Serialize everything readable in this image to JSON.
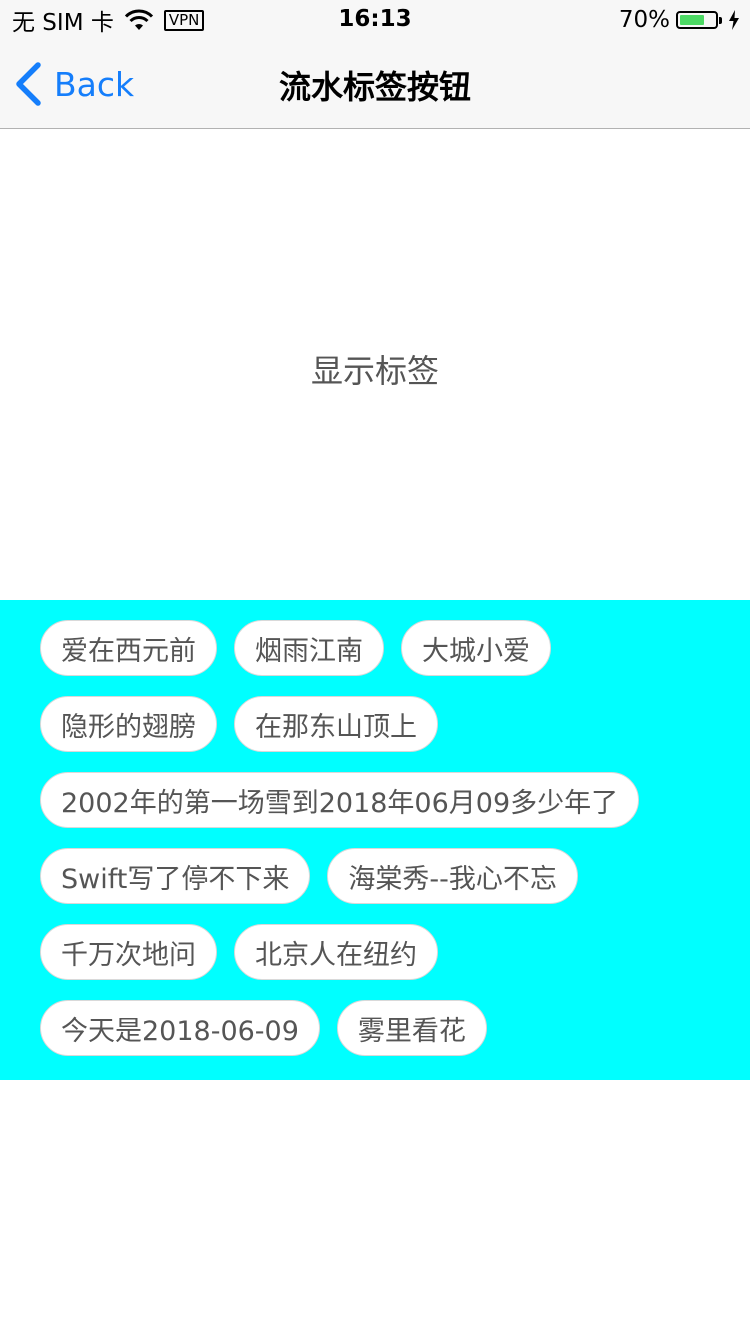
{
  "status_bar": {
    "carrier": "无 SIM 卡",
    "vpn": "VPN",
    "time": "16:13",
    "battery": "70%",
    "battery_level": 0.7,
    "battery_color": "#4cd964"
  },
  "nav": {
    "back_label": "Back",
    "title": "流水标签按钮",
    "accent": "#157efb"
  },
  "main": {
    "display_label": "显示标签"
  },
  "tags": {
    "background": "#00ffff",
    "rows": [
      [
        "爱在西元前",
        "烟雨江南",
        "大城小爱"
      ],
      [
        "隐形的翅膀",
        "在那东山顶上"
      ],
      [
        "2002年的第一场雪到2018年06月09多少年了"
      ],
      [
        "Swift写了停不下来",
        "海棠秀--我心不忘"
      ],
      [
        "千万次地问",
        "北京人在纽约"
      ],
      [
        "今天是2018-06-09",
        "雾里看花"
      ]
    ]
  }
}
